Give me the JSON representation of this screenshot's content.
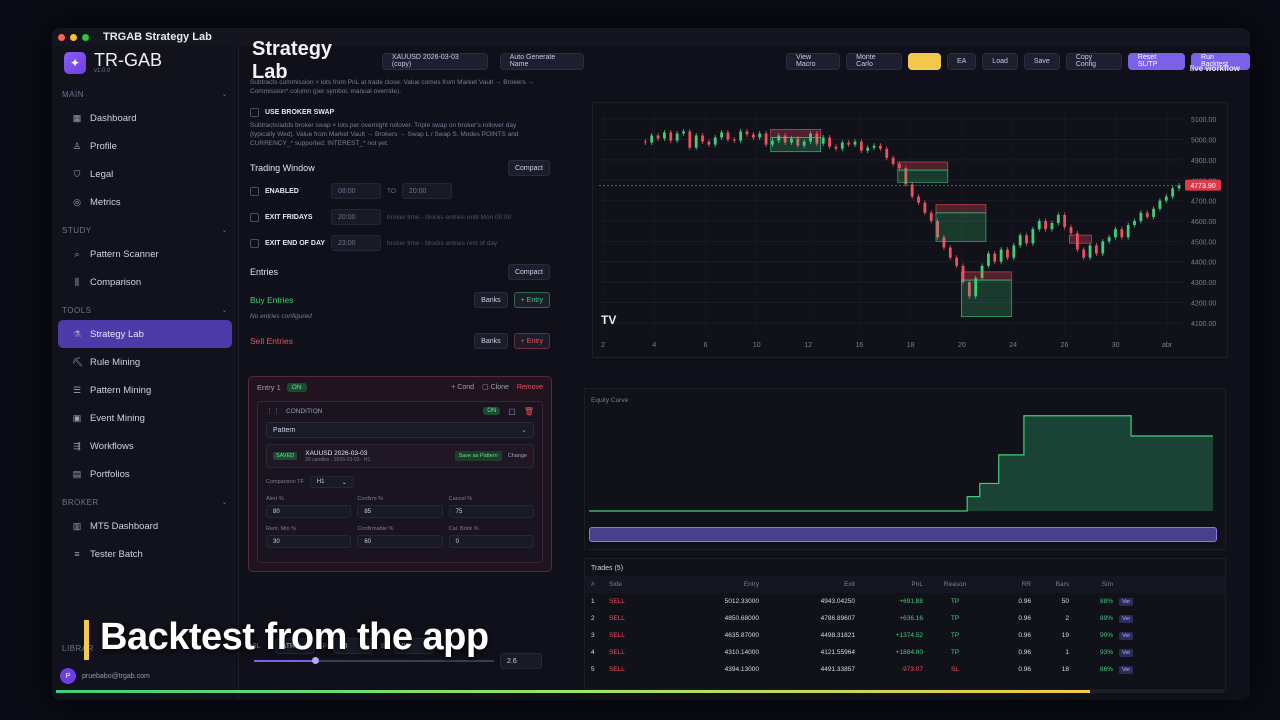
{
  "window": {
    "title": "TRGAB Strategy Lab"
  },
  "brand": {
    "name": "TR-GAB",
    "version": "v1.0.0"
  },
  "sidebar": {
    "sections": [
      {
        "label": "MAIN",
        "items": [
          {
            "label": "Dashboard",
            "icon": "grid-icon"
          },
          {
            "label": "Profile",
            "icon": "user-icon"
          },
          {
            "label": "Legal",
            "icon": "shield-icon"
          },
          {
            "label": "Metrics",
            "icon": "target-icon"
          }
        ]
      },
      {
        "label": "STUDY",
        "items": [
          {
            "label": "Pattern Scanner",
            "icon": "search-icon"
          },
          {
            "label": "Comparison",
            "icon": "columns-icon"
          }
        ]
      },
      {
        "label": "TOOLS",
        "items": [
          {
            "label": "Strategy Lab",
            "icon": "flask-icon",
            "active": true
          },
          {
            "label": "Rule Mining",
            "icon": "pickaxe-icon"
          },
          {
            "label": "Pattern Mining",
            "icon": "layers-icon"
          },
          {
            "label": "Event Mining",
            "icon": "calendar-icon"
          },
          {
            "label": "Workflows",
            "icon": "flow-icon"
          },
          {
            "label": "Portfolios",
            "icon": "briefcase-icon"
          }
        ]
      },
      {
        "label": "BROKER",
        "items": [
          {
            "label": "MT5 Dashboard",
            "icon": "chart-icon"
          },
          {
            "label": "Tester Batch",
            "icon": "list-icon"
          }
        ]
      }
    ],
    "library_label": "LIBRAR",
    "user_email": "pruebabo@trgab.com"
  },
  "header": {
    "title": "Strategy Lab",
    "strategy_name": "XAUUSD 2026-03-03 (copy)",
    "auto_name": "Auto Generate Name",
    "buttons": [
      "View Macro",
      "Monte Carlo",
      "",
      "EA",
      "Load",
      "Save",
      "Copy Config",
      "Reset SL/TP",
      "Run Backtest"
    ],
    "live_label": "live workflow"
  },
  "config": {
    "commission_note": "Subtracts commission × lots from PnL at trade close. Value comes from Market Vault → Brokers → Commission* column (per symbol, manual override).",
    "broker_swap_label": "USE BROKER SWAP",
    "broker_swap_note": "Subtracts/adds broker swap × lots per overnight rollover. Triple swap on broker's rollover day (typically Wed). Value from Market Vault → Brokers → Swap L / Swap S. Modes POINTS and CURRENCY_* supported; INTEREST_* not yet.",
    "trading_window": {
      "title": "Trading Window",
      "compact": "Compact",
      "enabled": "ENABLED",
      "from": "08:00",
      "to_label": "TO",
      "to": "20:00",
      "exit_fridays": "EXIT FRIDAYS",
      "exit_fridays_time": "20:00",
      "exit_fridays_note": "broker time - blocks entries until Mon 00:00",
      "exit_eod": "EXIT END OF DAY",
      "exit_eod_time": "23:00",
      "exit_eod_note": "broker time - blocks entries rest of day"
    },
    "entries": {
      "title": "Entries",
      "compact": "Compact",
      "buy_title": "Buy Entries",
      "banks": "Banks",
      "add_entry": "+ Entry",
      "no_entries": "No entries configured",
      "sell_title": "Sell Entries"
    },
    "entry_card": {
      "name": "Entry 1",
      "status": "ON",
      "cond": "+ Cond",
      "clone": "Clone",
      "remove": "Remove",
      "condition_label": "CONDITION",
      "condition_status": "ON",
      "type": "Pattern",
      "saved_badge": "SAVED",
      "pattern_name": "XAUUSD 2026-03-03",
      "pattern_sub": "20 candles · 2026-03-03 · H1",
      "save_as_pattern": "Save as Pattern",
      "change": "Change",
      "comparison_tf_label": "Comparison TF",
      "comparison_tf": "H1",
      "fields": [
        {
          "label": "Alert %",
          "value": "80"
        },
        {
          "label": "Confirm %",
          "value": "85"
        },
        {
          "label": "Cancel %",
          "value": "75"
        },
        {
          "label": "Rent. Min %",
          "value": "30"
        },
        {
          "label": "Confirmable %",
          "value": "60"
        },
        {
          "label": "Cal. Brick %",
          "value": "0"
        }
      ]
    },
    "sl": {
      "label": "SL",
      "type": "ATR",
      "p_label": "P:",
      "p_value": "14",
      "sh_label": "Sh:",
      "sh_value": "0",
      "slider_value": "2.6"
    }
  },
  "chart": {
    "x_labels": [
      "2",
      "4",
      "6",
      "10",
      "12",
      "16",
      "18",
      "20",
      "24",
      "26",
      "30",
      "abr"
    ],
    "y_labels": [
      "5100.00",
      "5000.00",
      "4900.00",
      "4800.00",
      "4700.00",
      "4600.00",
      "4500.00",
      "4400.00",
      "4300.00",
      "4200.00",
      "4100.00"
    ],
    "price_tag": "4773.90",
    "watermark": "TV",
    "price_path": [
      [
        0,
        4990
      ],
      [
        2,
        4985
      ],
      [
        4,
        5020
      ],
      [
        6,
        5005
      ],
      [
        8,
        5035
      ],
      [
        10,
        4995
      ],
      [
        12,
        5030
      ],
      [
        14,
        5040
      ],
      [
        16,
        4960
      ],
      [
        18,
        5020
      ],
      [
        20,
        4990
      ],
      [
        22,
        4975
      ],
      [
        24,
        5010
      ],
      [
        26,
        5035
      ],
      [
        28,
        5000
      ],
      [
        30,
        4995
      ],
      [
        32,
        5040
      ],
      [
        34,
        5025
      ],
      [
        36,
        5010
      ],
      [
        38,
        5030
      ],
      [
        40,
        4975
      ],
      [
        42,
        4995
      ],
      [
        44,
        5020
      ],
      [
        46,
        4985
      ],
      [
        48,
        5005
      ],
      [
        50,
        4970
      ],
      [
        52,
        4990
      ],
      [
        54,
        5030
      ],
      [
        56,
        4980
      ],
      [
        58,
        5010
      ],
      [
        60,
        4965
      ],
      [
        62,
        4955
      ],
      [
        64,
        4985
      ],
      [
        66,
        4975
      ],
      [
        68,
        4990
      ],
      [
        70,
        4945
      ],
      [
        72,
        4960
      ],
      [
        74,
        4970
      ],
      [
        76,
        4955
      ],
      [
        78,
        4910
      ],
      [
        80,
        4880
      ],
      [
        82,
        4860
      ],
      [
        84,
        4780
      ],
      [
        86,
        4720
      ],
      [
        88,
        4690
      ],
      [
        90,
        4640
      ],
      [
        92,
        4600
      ],
      [
        94,
        4520
      ],
      [
        96,
        4470
      ],
      [
        98,
        4420
      ],
      [
        100,
        4380
      ],
      [
        102,
        4300
      ],
      [
        104,
        4230
      ],
      [
        106,
        4320
      ],
      [
        108,
        4380
      ],
      [
        110,
        4440
      ],
      [
        112,
        4400
      ],
      [
        114,
        4460
      ],
      [
        116,
        4420
      ],
      [
        118,
        4480
      ],
      [
        120,
        4530
      ],
      [
        122,
        4490
      ],
      [
        124,
        4560
      ],
      [
        126,
        4600
      ],
      [
        128,
        4560
      ],
      [
        130,
        4590
      ],
      [
        132,
        4630
      ],
      [
        134,
        4570
      ],
      [
        136,
        4540
      ],
      [
        138,
        4460
      ],
      [
        140,
        4420
      ],
      [
        142,
        4480
      ],
      [
        144,
        4440
      ],
      [
        146,
        4500
      ],
      [
        148,
        4520
      ],
      [
        150,
        4560
      ],
      [
        152,
        4520
      ],
      [
        154,
        4580
      ],
      [
        156,
        4600
      ],
      [
        158,
        4640
      ],
      [
        160,
        4620
      ],
      [
        162,
        4660
      ],
      [
        164,
        4700
      ],
      [
        166,
        4720
      ],
      [
        168,
        4760
      ],
      [
        170,
        4774
      ]
    ]
  },
  "equity": {
    "title": "Equity Curve",
    "values": [
      0,
      0,
      0,
      0,
      0,
      0,
      0,
      0,
      0,
      0,
      0,
      0,
      0,
      0,
      0,
      0,
      0,
      0,
      0,
      0,
      0,
      0,
      0,
      0,
      0,
      0,
      0,
      0,
      0,
      0,
      0,
      0,
      0,
      0,
      0,
      0,
      0,
      0,
      0,
      0,
      0,
      0,
      0,
      0,
      0,
      0,
      0,
      0,
      0,
      0,
      0,
      0,
      0,
      0,
      0,
      0,
      0,
      0,
      0,
      0,
      691.88,
      691.88,
      1328.04,
      1328.04,
      1328.04,
      2702.56,
      2702.56,
      2702.56,
      2702.56,
      4587.36,
      4587.36,
      4587.36,
      4587.36,
      4587.36,
      4587.36,
      4587.36,
      4587.36,
      4587.36,
      4587.36,
      4587.36,
      4587.36,
      4587.36,
      4587.36,
      4587.36,
      4587.36,
      4587.36,
      3614.29,
      3614.29,
      3614.29,
      3614.29,
      3614.29,
      3614.29,
      3614.29,
      3614.29,
      3614.29,
      3614.29,
      3614.29,
      3614.29,
      3614.29,
      3614.29
    ]
  },
  "trades": {
    "title": "Trades (5)",
    "columns": [
      "#",
      "Side",
      "Entry",
      "Exit",
      "PnL",
      "Reason",
      "RR",
      "Bars",
      "Sim"
    ],
    "rows": [
      {
        "n": "1",
        "side": "SELL",
        "entry": "5012.33000",
        "exit": "4943.04250",
        "pnl": "+691.88",
        "reason": "TP",
        "rr": "0.96",
        "bars": "50",
        "sim": "88%",
        "action": "Ver"
      },
      {
        "n": "2",
        "side": "SELL",
        "entry": "4850.68000",
        "exit": "4786.89607",
        "pnl": "+636.16",
        "reason": "TP",
        "rr": "0.96",
        "bars": "2",
        "sim": "89%",
        "action": "Ver"
      },
      {
        "n": "3",
        "side": "SELL",
        "entry": "4635.87000",
        "exit": "4498.31821",
        "pnl": "+1374.52",
        "reason": "TP",
        "rr": "0.96",
        "bars": "19",
        "sim": "90%",
        "action": "Ver"
      },
      {
        "n": "4",
        "side": "SELL",
        "entry": "4310.14000",
        "exit": "4121.55964",
        "pnl": "+1884.80",
        "reason": "TP",
        "rr": "0.96",
        "bars": "1",
        "sim": "93%",
        "action": "Ver"
      },
      {
        "n": "5",
        "side": "SELL",
        "entry": "4394.13000",
        "exit": "4491.33857",
        "pnl": "-973.07",
        "reason": "SL",
        "rr": "0.96",
        "bars": "18",
        "sim": "86%",
        "action": "Ver"
      }
    ]
  },
  "caption": "Backtest from the app",
  "video": {
    "progress": 0.885
  },
  "colors": {
    "accent": "#7b61e8",
    "buy": "#3fcf7a",
    "sell": "#ef4f5f",
    "warning": "#f2c94c"
  }
}
